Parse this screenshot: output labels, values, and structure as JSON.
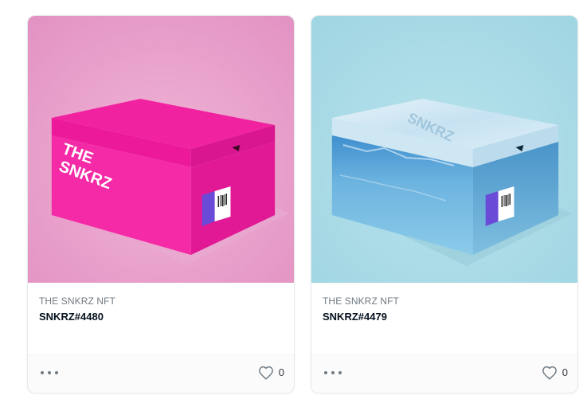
{
  "cards": [
    {
      "collection": "THE SNKRZ NFT",
      "token": "SNKRZ#4480",
      "likes": "0",
      "image": {
        "background": "#e9a7ce",
        "box_color": "#f41fa4",
        "box_label": "THE SNKRZ",
        "label_strip": "SNKRZ"
      },
      "icons": {
        "more": "more-icon",
        "like": "heart-icon"
      }
    },
    {
      "collection": "THE SNKRZ NFT",
      "token": "SNKRZ#4479",
      "likes": "0",
      "image": {
        "background": "#a9dbe6",
        "box_color": "#5fa9d6",
        "box_label": "SNKRZ",
        "label_strip": "SNKRZ"
      },
      "icons": {
        "more": "more-icon",
        "like": "heart-icon"
      }
    }
  ]
}
